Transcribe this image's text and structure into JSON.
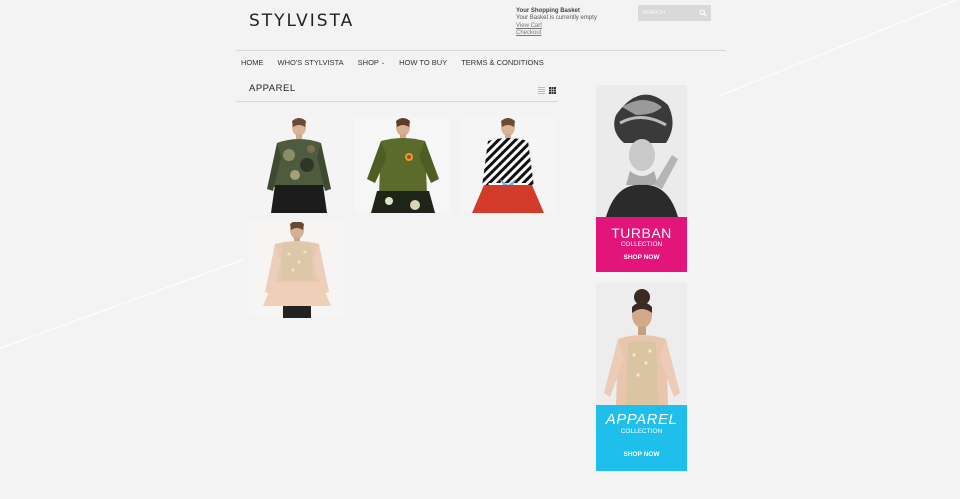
{
  "header": {
    "logo": "STYLVISTA",
    "basket": {
      "title": "Your Shopping Basket",
      "status": "Your Basket is currently empty",
      "view_cart": "View Cart",
      "checkout": "Checkout"
    },
    "search": {
      "placeholder": "SEARCH",
      "icon": "search-icon"
    }
  },
  "nav": {
    "items": [
      {
        "label": "HOME"
      },
      {
        "label": "WHO'S STYLVISTA"
      },
      {
        "label": "SHOP"
      },
      {
        "label": "HOW TO BUY"
      },
      {
        "label": "TERMS & CONDITIONS"
      }
    ]
  },
  "main": {
    "section_title": "APPAREL",
    "view_modes": [
      "list-view-icon",
      "grid-view-icon"
    ],
    "products": [
      {
        "image": "camouflage-print-top"
      },
      {
        "image": "olive-green-peplum-top"
      },
      {
        "image": "striped-red-skirt-top"
      },
      {
        "image": "sequin-peach-peplum-top"
      }
    ]
  },
  "sidebar": {
    "banners": [
      {
        "title": "TURBAN",
        "subtitle": "COLLECTION",
        "cta": "SHOP NOW",
        "color": "#e3157a"
      },
      {
        "title": "APPAREL",
        "subtitle": "COLLECTION",
        "cta": "SHOP NOW",
        "color": "#1ebfea"
      }
    ]
  }
}
